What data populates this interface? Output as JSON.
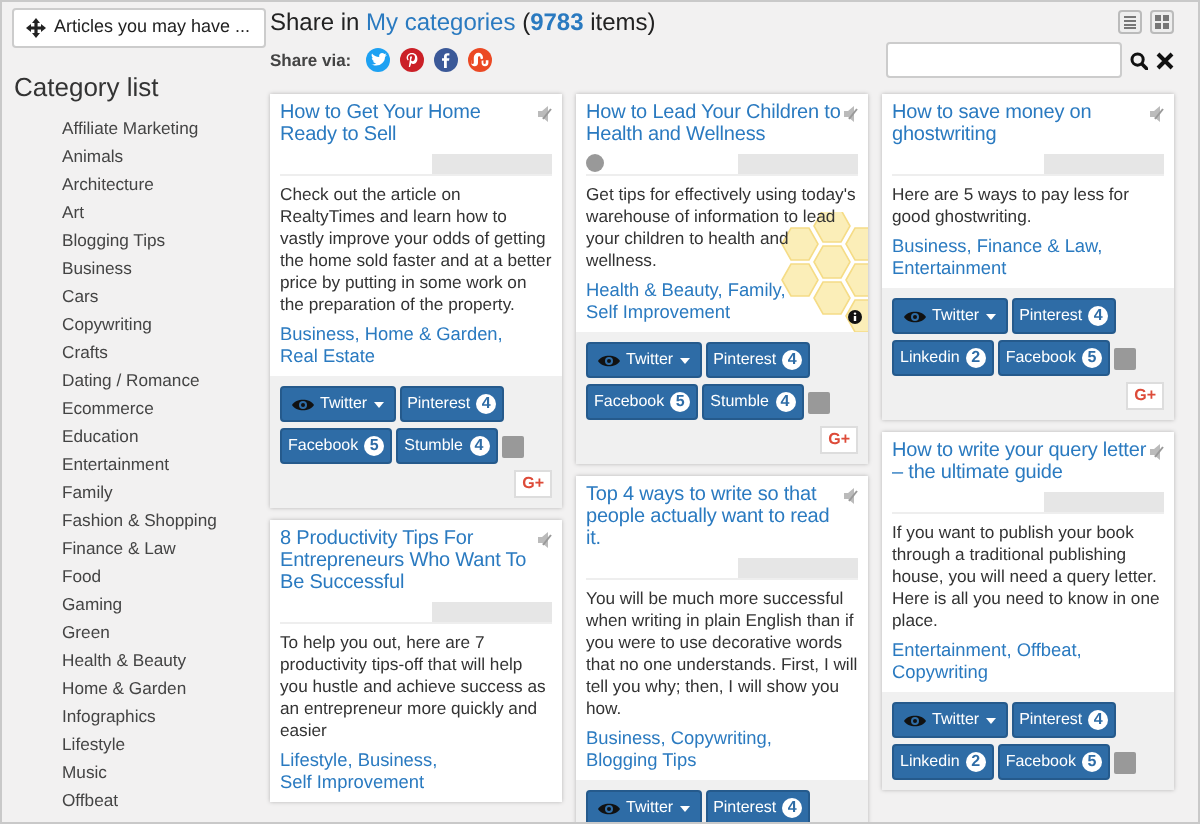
{
  "sidebar": {
    "top_button": "Articles you may have ...",
    "title": "Category list",
    "categories": [
      "Affiliate Marketing",
      "Animals",
      "Architecture",
      "Art",
      "Blogging Tips",
      "Business",
      "Cars",
      "Copywriting",
      "Crafts",
      "Dating / Romance",
      "Ecommerce",
      "Education",
      "Entertainment",
      "Family",
      "Fashion & Shopping",
      "Finance & Law",
      "Food",
      "Gaming",
      "Green",
      "Health & Beauty",
      "Home & Garden",
      "Infographics",
      "Lifestyle",
      "Music",
      "Offbeat"
    ]
  },
  "heading": [
    {
      "text": "Share in ",
      "link": false
    },
    {
      "text": "My categories",
      "link": true
    },
    {
      "text": " (",
      "link": false
    },
    {
      "text": "9783",
      "link": true
    },
    {
      "text": " items)",
      "link": false
    }
  ],
  "share": {
    "label": "Share via:",
    "icons": [
      {
        "kind": "twitter",
        "color": "#1da1f2"
      },
      {
        "kind": "pinterest",
        "color": "#cb2027"
      },
      {
        "kind": "facebook",
        "color": "#3b5998"
      },
      {
        "kind": "stumbleupon",
        "color": "#eb4924"
      }
    ]
  },
  "columns": [
    [
      {
        "title": "How to Get Your Home Ready to Sell",
        "description": "Check out the article on RealtyTimes and learn how to vastly improve your odds of getting the home sold faster and at a better price by putting in some work on the preparation of the property.",
        "tags": [
          "Business,",
          "Home & Garden,",
          "Real Estate"
        ],
        "buttons": [
          {
            "kind": "twitter",
            "label": "Twitter"
          },
          {
            "kind": "count",
            "label": "Pinterest",
            "count": "4"
          },
          {
            "kind": "count",
            "label": "Facebook",
            "count": "5"
          },
          {
            "kind": "count",
            "label": "Stumble",
            "count": "4"
          },
          {
            "kind": "square"
          },
          {
            "kind": "gplus",
            "label": "G+"
          }
        ]
      },
      {
        "title": "8 Productivity Tips For Entrepreneurs Who Want To Be Successful",
        "description": "To help you out, here are 7 productivity tips-off that will help you hustle and achieve success as an entrepreneur more quickly and easier",
        "tags": [
          "Lifestyle,",
          "Business,",
          "Self Improvement"
        ]
      }
    ],
    [
      {
        "title": "How to Lead Your Children to Health and Wellness",
        "avatar": true,
        "overlay": true,
        "description": "Get tips for effectively using today's warehouse of information to lead your children to health and wellness.",
        "tags": [
          "Health & Beauty,",
          "Family,",
          "Self Improvement"
        ],
        "buttons": [
          {
            "kind": "twitter",
            "label": "Twitter"
          },
          {
            "kind": "count",
            "label": "Pinterest",
            "count": "4"
          },
          {
            "kind": "count",
            "label": "Facebook",
            "count": "5"
          },
          {
            "kind": "count",
            "label": "Stumble",
            "count": "4"
          },
          {
            "kind": "square"
          },
          {
            "kind": "gplus",
            "label": "G+"
          }
        ]
      },
      {
        "title": "Top 4 ways to write so that people actually want to read it.",
        "description": "You will be much more successful when writing in plain English than if you were to use decorative words that no one understands. First, I will tell you why; then, I will show you how.",
        "tags": [
          "Business,",
          "Copywriting,",
          "Blogging Tips"
        ],
        "buttons": [
          {
            "kind": "twitter",
            "label": "Twitter"
          },
          {
            "kind": "count",
            "label": "Pinterest",
            "count": "4"
          }
        ]
      }
    ],
    [
      {
        "title": "How to save money on ghostwriting",
        "description": "Here are 5 ways to pay less for good ghostwriting.",
        "tags": [
          "Business,",
          "Finance & Law,",
          "Entertainment"
        ],
        "buttons": [
          {
            "kind": "twitter",
            "label": "Twitter"
          },
          {
            "kind": "count",
            "label": "Pinterest",
            "count": "4"
          },
          {
            "kind": "count",
            "label": "Linkedin",
            "count": "2"
          },
          {
            "kind": "count",
            "label": "Facebook",
            "count": "5"
          },
          {
            "kind": "square"
          },
          {
            "kind": "gplus",
            "label": "G+"
          }
        ]
      },
      {
        "title": "How to write your query letter – the ultimate guide",
        "description": "If you want to publish your book through a traditional publishing house, you will need a query letter. Here is all you need to know in one place.",
        "tags": [
          "Entertainment,",
          "Offbeat,",
          "Copywriting"
        ],
        "buttons": [
          {
            "kind": "twitter",
            "label": "Twitter"
          },
          {
            "kind": "count",
            "label": "Pinterest",
            "count": "4"
          },
          {
            "kind": "count",
            "label": "Linkedin",
            "count": "2"
          },
          {
            "kind": "count",
            "label": "Facebook",
            "count": "5"
          },
          {
            "kind": "square"
          }
        ]
      }
    ]
  ]
}
